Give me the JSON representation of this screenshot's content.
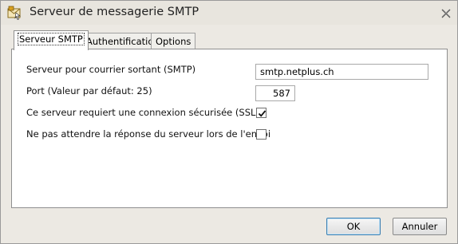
{
  "window": {
    "title": "Serveur de messagerie SMTP"
  },
  "tabs": [
    {
      "label": "Serveur SMTP",
      "active": true
    },
    {
      "label": "Authentification",
      "active": false
    },
    {
      "label": "Options",
      "active": false
    }
  ],
  "form": {
    "smtp_server_label": "Serveur pour courrier sortant (SMTP)",
    "smtp_server_value": "smtp.netplus.ch",
    "port_label": "Port (Valeur par défaut: 25)",
    "port_value": "587",
    "ssl_label": "Ce serveur requiert une connexion sécurisée (SSL)",
    "ssl_checked": true,
    "no_wait_label": "Ne pas attendre la réponse du serveur lors de l'envoi",
    "no_wait_checked": false
  },
  "buttons": {
    "ok_label": "OK",
    "cancel_label": "Annuler"
  },
  "icons": {
    "app": "mail-envelope-icon",
    "close": "close-icon",
    "check": "checkmark-icon"
  }
}
